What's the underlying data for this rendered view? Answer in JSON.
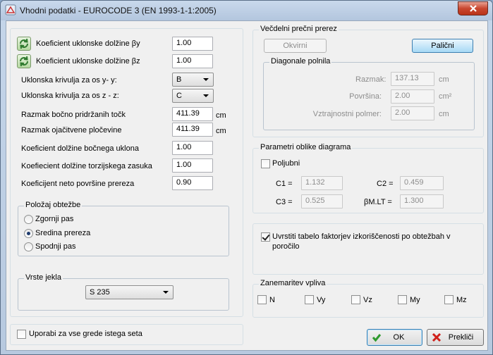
{
  "window": {
    "title": "Vhodni podatki - EUROCODE 3 (EN 1993-1-1:2005)"
  },
  "left": {
    "fields": [
      {
        "label": "Koeficient uklonske dolžine  βy",
        "value": "1.00",
        "unit": ""
      },
      {
        "label": "Koeficient uklonske dolžine  βz",
        "value": "1.00",
        "unit": ""
      },
      {
        "label": "Razmak bočno pridržanih točk",
        "value": "411.39",
        "unit": "cm"
      },
      {
        "label": "Razmak ojačitvene pločevine",
        "value": "411.39",
        "unit": "cm"
      },
      {
        "label": "Koeficient dolžine bočnega uklona",
        "value": "1.00",
        "unit": ""
      },
      {
        "label": "Koefiecient dolžine torzijskega zasuka",
        "value": "1.00",
        "unit": ""
      },
      {
        "label": "Koeficijent neto površine prereza",
        "value": "0.90",
        "unit": ""
      }
    ],
    "buckling": [
      {
        "label": "Uklonska krivulja za os y- y:",
        "value": "B"
      },
      {
        "label": "Uklonska krivulja za os z - z:",
        "value": "C"
      }
    ],
    "load_position": {
      "legend": "Položaj obtežbe",
      "options": [
        "Zgornji pas",
        "Sredina prereza",
        "Spodnji pas"
      ],
      "selected": 1
    },
    "steel": {
      "legend": "Vrste jekla",
      "value": "S 235"
    },
    "apply_all_label": "Uporabi za vse grede istega seta"
  },
  "section": {
    "legend": "Večdelni prečni prerez",
    "btn_okvirni": "Okvirni",
    "btn_palicni": "Palični",
    "diagonals": {
      "legend": "Diagonale polnila",
      "rows": [
        {
          "label": "Razmak:",
          "value": "137.13",
          "unit": "cm"
        },
        {
          "label": "Površina:",
          "value": "2.00",
          "unit": "cm²"
        },
        {
          "label": "Vztrajnostni polmer:",
          "value": "2.00",
          "unit": "cm"
        }
      ]
    }
  },
  "diagram": {
    "legend": "Parametri oblike diagrama",
    "arbitrary_label": "Poljubni",
    "c1_label": "C1 =",
    "c1": "1.132",
    "c2_label": "C2 =",
    "c2": "0.459",
    "c3_label": "C3 =",
    "c3": "0.525",
    "bm_label": "βM.LT =",
    "bm": "1.300"
  },
  "report": {
    "label": "Uvrstiti tabelo faktorjev izkoriščenosti po obtežbah v poročilo",
    "checked": true
  },
  "ignore": {
    "legend": "Zanemaritev vpliva",
    "items": [
      "N",
      "Vy",
      "Vz",
      "My",
      "Mz"
    ]
  },
  "buttons": {
    "ok": "OK",
    "cancel": "Prekliči"
  },
  "colors": {
    "ok_check": "#2e9a2e",
    "cancel_x": "#d0201a"
  }
}
